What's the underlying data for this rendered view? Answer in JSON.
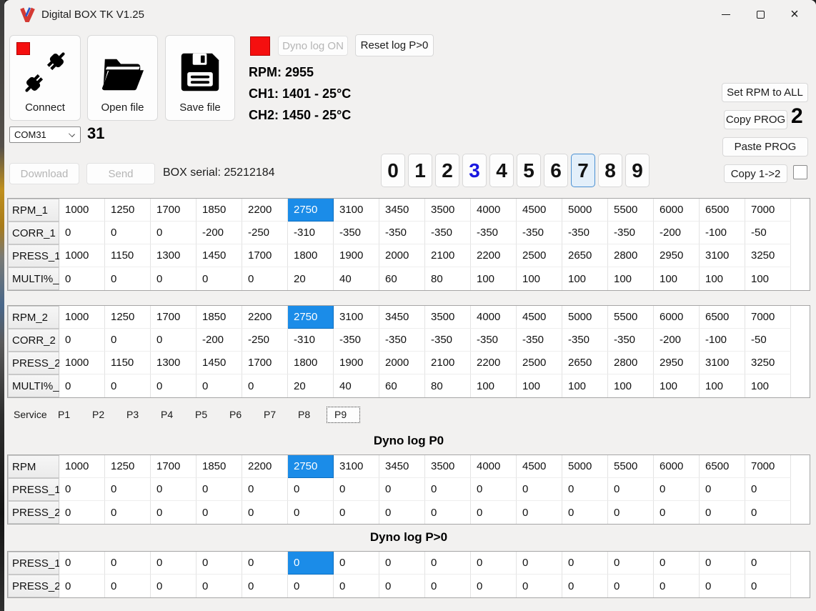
{
  "window": {
    "title": "Digital BOX TK V1.25"
  },
  "colors": {
    "selection_blue": "#1b8ce8",
    "led_red": "#f50f0f",
    "digit_blue": "#1a18e0"
  },
  "toolbar": {
    "connect": "Connect",
    "open_file": "Open file",
    "save_file": "Save file",
    "dyno_log": "Dyno log ON",
    "reset_log": "Reset log P>0",
    "com_port": "COM31",
    "com_number": "31",
    "download": "Download",
    "send": "Send",
    "box_serial": "BOX serial: 25212184"
  },
  "telemetry": {
    "rpm": "RPM: 2955",
    "ch1": "CH1: 1401 - 25°C",
    "ch2": "CH2: 1450 - 25°C"
  },
  "prog_actions": {
    "set_rpm_to_all": "Set RPM to ALL",
    "copy_prog": "Copy PROG",
    "copy_count": "2",
    "paste_prog": "Paste PROG",
    "copy_1_to_2": "Copy 1->2"
  },
  "prog_digits": {
    "buttons": [
      "0",
      "1",
      "2",
      "3",
      "4",
      "5",
      "6",
      "7",
      "8",
      "9"
    ],
    "blue_digit_index": 3,
    "selected_index": 7
  },
  "tabs": {
    "items": [
      "Service",
      "P1",
      "P2",
      "P3",
      "P4",
      "P5",
      "P6",
      "P7",
      "P8",
      "P9"
    ],
    "selected": "P9"
  },
  "sections": {
    "dyno_p0_title": "Dyno log  P0",
    "dyno_pgt0_title": "Dyno log  P>0"
  },
  "tables": [
    {
      "id": "prog1",
      "rows": [
        {
          "header": "RPM_1",
          "selected_col": 5,
          "values": [
            1000,
            1250,
            1700,
            1850,
            2200,
            2750,
            3100,
            3450,
            3500,
            4000,
            4500,
            5000,
            5500,
            6000,
            6500,
            7000
          ]
        },
        {
          "header": "CORR_1",
          "values": [
            0,
            0,
            0,
            -200,
            -250,
            -310,
            -350,
            -350,
            -350,
            -350,
            -350,
            -350,
            -350,
            -200,
            -100,
            -50
          ]
        },
        {
          "header": "PRESS_1",
          "values": [
            1000,
            1150,
            1300,
            1450,
            1700,
            1800,
            1900,
            2000,
            2100,
            2200,
            2500,
            2650,
            2800,
            2950,
            3100,
            3250
          ]
        },
        {
          "header": "MULTI%_",
          "values": [
            0,
            0,
            0,
            0,
            0,
            20,
            40,
            60,
            80,
            100,
            100,
            100,
            100,
            100,
            100,
            100
          ]
        }
      ]
    },
    {
      "id": "prog2",
      "rows": [
        {
          "header": "RPM_2",
          "selected_col": 5,
          "values": [
            1000,
            1250,
            1700,
            1850,
            2200,
            2750,
            3100,
            3450,
            3500,
            4000,
            4500,
            5000,
            5500,
            6000,
            6500,
            7000
          ]
        },
        {
          "header": "CORR_2",
          "values": [
            0,
            0,
            0,
            -200,
            -250,
            -310,
            -350,
            -350,
            -350,
            -350,
            -350,
            -350,
            -350,
            -200,
            -100,
            -50
          ]
        },
        {
          "header": "PRESS_2",
          "values": [
            1000,
            1150,
            1300,
            1450,
            1700,
            1800,
            1900,
            2000,
            2100,
            2200,
            2500,
            2650,
            2800,
            2950,
            3100,
            3250
          ]
        },
        {
          "header": "MULTI%_",
          "values": [
            0,
            0,
            0,
            0,
            0,
            20,
            40,
            60,
            80,
            100,
            100,
            100,
            100,
            100,
            100,
            100
          ]
        }
      ]
    },
    {
      "id": "dyno_p0",
      "rows": [
        {
          "header": "RPM",
          "selected_col": 5,
          "values": [
            1000,
            1250,
            1700,
            1850,
            2200,
            2750,
            3100,
            3450,
            3500,
            4000,
            4500,
            5000,
            5500,
            6000,
            6500,
            7000
          ]
        },
        {
          "header": "PRESS_1",
          "values": [
            0,
            0,
            0,
            0,
            0,
            0,
            0,
            0,
            0,
            0,
            0,
            0,
            0,
            0,
            0,
            0
          ]
        },
        {
          "header": "PRESS_2",
          "values": [
            0,
            0,
            0,
            0,
            0,
            0,
            0,
            0,
            0,
            0,
            0,
            0,
            0,
            0,
            0,
            0
          ]
        }
      ]
    },
    {
      "id": "dyno_pgt0",
      "rows": [
        {
          "header": "PRESS_1",
          "selected_col": 5,
          "values": [
            0,
            0,
            0,
            0,
            0,
            0,
            0,
            0,
            0,
            0,
            0,
            0,
            0,
            0,
            0,
            0
          ]
        },
        {
          "header": "PRESS_2",
          "values": [
            0,
            0,
            0,
            0,
            0,
            0,
            0,
            0,
            0,
            0,
            0,
            0,
            0,
            0,
            0,
            0
          ]
        }
      ]
    }
  ]
}
